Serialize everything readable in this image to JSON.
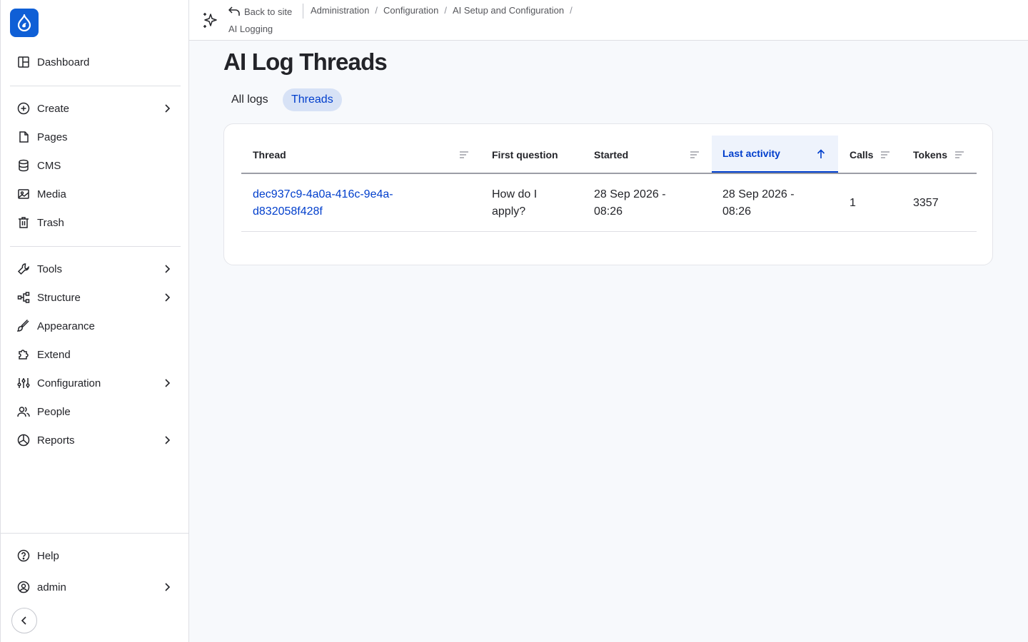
{
  "sidebar": {
    "logo_icon": "drupal-drop-icon",
    "dashboard": "Dashboard",
    "items": [
      {
        "label": "Create",
        "icon": "plus-circle-icon",
        "has_children": true
      },
      {
        "label": "Pages",
        "icon": "file-icon",
        "has_children": false
      },
      {
        "label": "CMS",
        "icon": "database-icon",
        "has_children": false
      },
      {
        "label": "Media",
        "icon": "image-icon",
        "has_children": false
      },
      {
        "label": "Trash",
        "icon": "trash-icon",
        "has_children": false
      },
      {
        "label": "Tools",
        "icon": "wrench-icon",
        "has_children": true
      },
      {
        "label": "Structure",
        "icon": "structure-icon",
        "has_children": true
      },
      {
        "label": "Appearance",
        "icon": "brush-icon",
        "has_children": false
      },
      {
        "label": "Extend",
        "icon": "puzzle-icon",
        "has_children": false
      },
      {
        "label": "Configuration",
        "icon": "sliders-icon",
        "has_children": true
      },
      {
        "label": "People",
        "icon": "people-icon",
        "has_children": false
      },
      {
        "label": "Reports",
        "icon": "chart-pie-icon",
        "has_children": true
      }
    ],
    "help": "Help",
    "user": "admin"
  },
  "topbar": {
    "back_label": "Back to site",
    "breadcrumbs": [
      "Administration",
      "Configuration",
      "AI Setup and Configuration"
    ],
    "current": "AI Logging"
  },
  "page": {
    "title": "AI Log Threads",
    "tabs": [
      {
        "label": "All logs",
        "active": false
      },
      {
        "label": "Threads",
        "active": true
      }
    ]
  },
  "table": {
    "columns": [
      "Thread",
      "First question",
      "Started",
      "Last activity",
      "Calls",
      "Tokens"
    ],
    "rows": [
      {
        "thread_line1": "dec937c9-4a0a-416c-9e4a-",
        "thread_line2": "d832058f428f",
        "question_line1": "How do I",
        "question_line2": "apply?",
        "started_line1": "28 Sep 2026 -",
        "started_line2": "08:26",
        "last_line1": "28 Sep 2026 -",
        "last_line2": "08:26",
        "calls": "1",
        "tokens": "3357"
      }
    ]
  },
  "colors": {
    "accent": "#003ecc",
    "logo_bg": "#0f5fd6",
    "active_tab_bg": "#d7e2f6",
    "active_header_bg": "#eef3fc"
  }
}
